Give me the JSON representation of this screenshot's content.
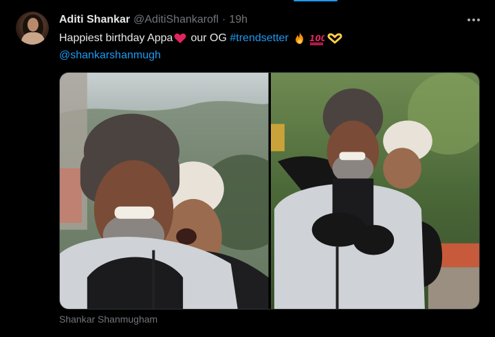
{
  "tweet": {
    "display_name": "Aditi Shankar",
    "handle": "@AditiShankarofl",
    "separator": "·",
    "time": "19h",
    "text_part1": "Happiest birthday Appa",
    "text_part2": "our OG",
    "hashtag": "#trendsetter",
    "mention": "@shankarshanmugh",
    "emojis": [
      "heart-icon",
      "fire-icon",
      "hundred-points-icon",
      "heart-hands-icon"
    ],
    "media_caption": "Shankar Shanmugham"
  },
  "colors": {
    "background": "#000000",
    "text": "#e7e9ea",
    "muted": "#71767b",
    "link": "#1d9bf0",
    "heart": "#e0245e"
  }
}
